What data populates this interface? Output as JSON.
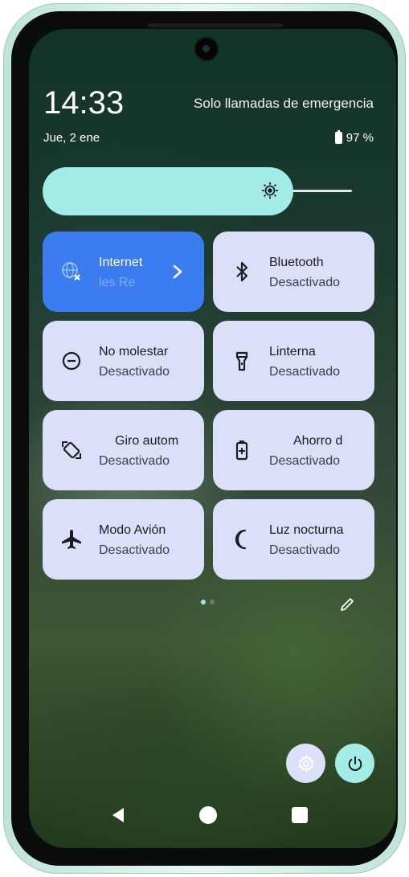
{
  "status": {
    "time": "14:33",
    "network": "Solo llamadas de emergencia",
    "date": "Jue, 2 ene",
    "battery": "97 %"
  },
  "brightness": {
    "level": 0.78,
    "icon": "brightness-icon"
  },
  "tiles": [
    {
      "title": "Internet",
      "subtitle": "les   Re",
      "icon": "globe-off-icon",
      "active": true
    },
    {
      "title": "Bluetooth",
      "subtitle": "Desactivado",
      "icon": "bluetooth-icon",
      "active": false
    },
    {
      "title": "No molestar",
      "subtitle": "Desactivado",
      "icon": "do-not-disturb-icon",
      "active": false
    },
    {
      "title": "Linterna",
      "subtitle": "Desactivado",
      "icon": "flashlight-icon",
      "active": false
    },
    {
      "title": "Giro autom",
      "subtitle": "Desactivado",
      "icon": "auto-rotate-icon",
      "active": false
    },
    {
      "title": "Ahorro d",
      "subtitle": "Desactivado",
      "icon": "battery-saver-icon",
      "active": false
    },
    {
      "title": "Modo Avión",
      "subtitle": "Desactivado",
      "icon": "airplane-icon",
      "active": false
    },
    {
      "title": "Luz nocturna",
      "subtitle": "Desactivado",
      "icon": "night-light-icon",
      "active": false
    }
  ],
  "pager": {
    "pages": 2,
    "current": 1
  },
  "colors": {
    "accent": "#3b7df0",
    "tile": "#dcdff8",
    "mint": "#a3ece7"
  }
}
